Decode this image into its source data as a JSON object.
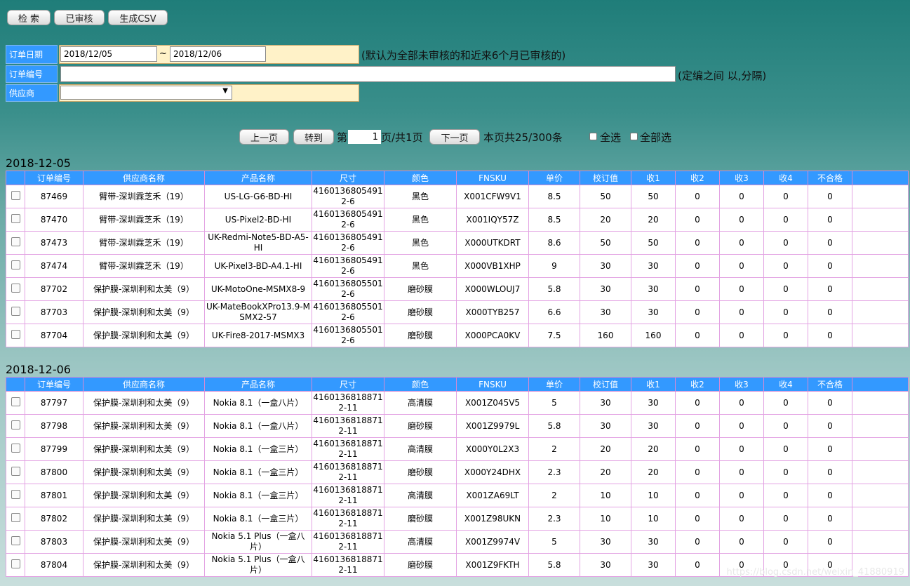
{
  "toolbar": {
    "search": "检 索",
    "approved": "已审核",
    "csv": "生成CSV"
  },
  "filters": {
    "date_label": "订单日期",
    "date_from": "2018/12/05",
    "tilde": "~",
    "date_to": "2018/12/06",
    "date_hint": "(默认为全部未审核的和近来6个月已审核的)",
    "order_label": "订单编号",
    "order_value": "",
    "order_hint": "(定编之间 以,分隔)",
    "supplier_label": "供应商",
    "supplier_value": ""
  },
  "pager": {
    "prev": "上一页",
    "goto": "转到",
    "di": "第",
    "page": "1",
    "of_total": "页/共1页",
    "next": "下一页",
    "summary": "本页共25/300条",
    "select_all": "全选",
    "select_all_pages": "全部选"
  },
  "columns": [
    "订单编号",
    "供应商名称",
    "产品名称",
    "尺寸",
    "颜色",
    "FNSKU",
    "单价",
    "校订值",
    "收1",
    "收2",
    "收3",
    "收4",
    "不合格"
  ],
  "groups": [
    {
      "date": "2018-12-05",
      "rows": [
        [
          "87469",
          "臂带-深圳霖芝禾（19）",
          "US-LG-G6-BD-HI",
          "41601368054912-6",
          "黑色",
          "X001CFW9V1",
          "8.5",
          "50",
          "50",
          "0",
          "0",
          "0",
          "0"
        ],
        [
          "87470",
          "臂带-深圳霖芝禾（19）",
          "US-Pixel2-BD-HI",
          "41601368054912-6",
          "黑色",
          "X001IQY57Z",
          "8.5",
          "20",
          "20",
          "0",
          "0",
          "0",
          "0"
        ],
        [
          "87473",
          "臂带-深圳霖芝禾（19）",
          "UK-Redmi-Note5-BD-A5-HI",
          "41601368054912-6",
          "黑色",
          "X000UTKDRT",
          "8.6",
          "50",
          "50",
          "0",
          "0",
          "0",
          "0"
        ],
        [
          "87474",
          "臂带-深圳霖芝禾（19）",
          "UK-Pixel3-BD-A4.1-HI",
          "41601368054912-6",
          "黑色",
          "X000VB1XHP",
          "9",
          "30",
          "30",
          "0",
          "0",
          "0",
          "0"
        ],
        [
          "87702",
          "保护膜-深圳利和太美（9）",
          "UK-MotoOne-MSMX8-9",
          "41601368055012-6",
          "磨砂膜",
          "X000WLOUJ7",
          "5.8",
          "30",
          "30",
          "0",
          "0",
          "0",
          "0"
        ],
        [
          "87703",
          "保护膜-深圳利和太美（9）",
          "UK-MateBookXPro13.9-MSMX2-57",
          "41601368055012-6",
          "磨砂膜",
          "X000TYB257",
          "6.6",
          "30",
          "30",
          "0",
          "0",
          "0",
          "0"
        ],
        [
          "87704",
          "保护膜-深圳利和太美（9）",
          "UK-Fire8-2017-MSMX3",
          "41601368055012-6",
          "磨砂膜",
          "X000PCA0KV",
          "7.5",
          "160",
          "160",
          "0",
          "0",
          "0",
          "0"
        ]
      ]
    },
    {
      "date": "2018-12-06",
      "rows": [
        [
          "87797",
          "保护膜-深圳利和太美（9）",
          "Nokia 8.1（一盒八片）",
          "41601368188712-11",
          "高清膜",
          "X001Z045V5",
          "5",
          "30",
          "30",
          "0",
          "0",
          "0",
          "0"
        ],
        [
          "87798",
          "保护膜-深圳利和太美（9）",
          "Nokia 8.1（一盒八片）",
          "41601368188712-11",
          "磨砂膜",
          "X001Z9979L",
          "5.8",
          "30",
          "30",
          "0",
          "0",
          "0",
          "0"
        ],
        [
          "87799",
          "保护膜-深圳利和太美（9）",
          "Nokia 8.1（一盒三片）",
          "41601368188712-11",
          "高清膜",
          "X000Y0L2X3",
          "2",
          "20",
          "20",
          "0",
          "0",
          "0",
          "0"
        ],
        [
          "87800",
          "保护膜-深圳利和太美（9）",
          "Nokia 8.1（一盒三片）",
          "41601368188712-11",
          "磨砂膜",
          "X000Y24DHX",
          "2.3",
          "20",
          "20",
          "0",
          "0",
          "0",
          "0"
        ],
        [
          "87801",
          "保护膜-深圳利和太美（9）",
          "Nokia 8.1（一盒三片）",
          "41601368188712-11",
          "高清膜",
          "X001ZA69LT",
          "2",
          "10",
          "10",
          "0",
          "0",
          "0",
          "0"
        ],
        [
          "87802",
          "保护膜-深圳利和太美（9）",
          "Nokia 8.1（一盒三片）",
          "41601368188712-11",
          "磨砂膜",
          "X001Z98UKN",
          "2.3",
          "10",
          "10",
          "0",
          "0",
          "0",
          "0"
        ],
        [
          "87803",
          "保护膜-深圳利和太美（9）",
          "Nokia 5.1 Plus（一盒八片）",
          "41601368188712-11",
          "高清膜",
          "X001Z9974V",
          "5",
          "30",
          "30",
          "0",
          "0",
          "0",
          "0"
        ],
        [
          "87804",
          "保护膜-深圳利和太美（9）",
          "Nokia 5.1 Plus（一盒八片）",
          "41601368188712-11",
          "磨砂膜",
          "X001Z9FKTH",
          "5.8",
          "30",
          "30",
          "0",
          "0",
          "0",
          "0"
        ]
      ]
    }
  ],
  "watermark": "https://blog.csdn.net/weixin_41880919"
}
